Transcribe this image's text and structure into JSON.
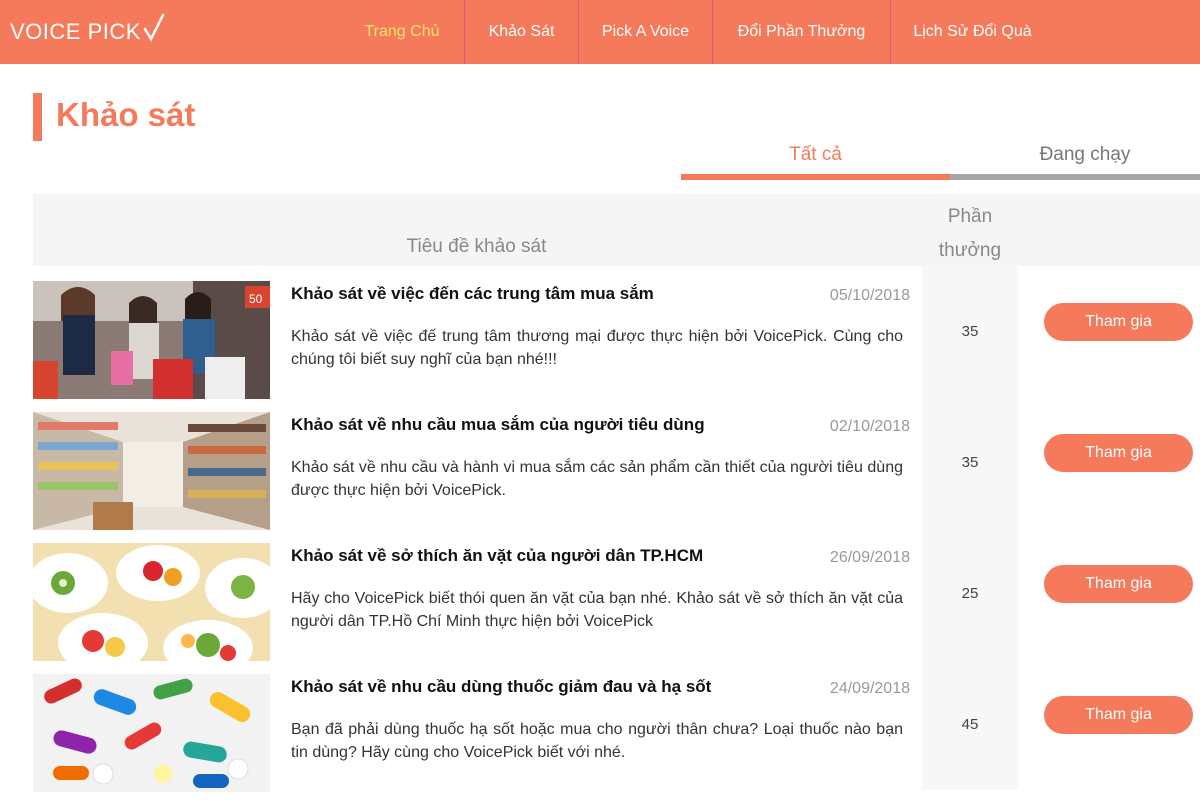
{
  "header": {
    "logo_text": "VOICE PICK",
    "nav": [
      {
        "label": "Trang Chủ",
        "active": true
      },
      {
        "label": "Khảo Sát",
        "active": false
      },
      {
        "label": "Pick A Voice",
        "active": false
      },
      {
        "label": "Đổi Phần Thưởng",
        "active": false
      },
      {
        "label": "Lịch Sử Đổi Quà",
        "active": false
      }
    ]
  },
  "page": {
    "title": "Khảo sát",
    "tabs": [
      {
        "label": "Tất cả",
        "active": true
      },
      {
        "label": "Đang chạy",
        "active": false
      }
    ]
  },
  "table": {
    "header_title": "Tiêu đề khảo sát",
    "header_reward_line1": "Phần",
    "header_reward_line2": "thưởng"
  },
  "surveys": [
    {
      "title": "Khảo sát về việc đến các trung tâm mua sắm",
      "date": "05/10/2018",
      "description": "Khảo sát về việc đế trung tâm thương mại được thực hiện bởi VoicePick. Cùng cho chúng tôi biết suy nghĩ của bạn nhé!!!",
      "reward": "35",
      "button": "Tham gia",
      "image": "shopping-women-photo"
    },
    {
      "title": "Khảo sát về nhu cầu mua sắm của người tiêu dùng",
      "date": "02/10/2018",
      "description": "Khảo sát về nhu cầu và hành vi mua sắm các sản phẩm cần thiết của người tiêu dùng được thực hiện bởi VoicePick.",
      "reward": "35",
      "button": "Tham gia",
      "image": "supermarket-aisle-photo"
    },
    {
      "title": "Khảo sát về sở thích ăn vặt của người dân TP.HCM",
      "date": "26/09/2018",
      "description": "Hãy cho VoicePick biết thói quen ăn vặt của bạn nhé. Khảo sát về sở thích ăn vặt của người dân TP.Hồ Chí Minh thực hiện bởi VoicePick",
      "reward": "25",
      "button": "Tham gia",
      "image": "fruit-salad-photo"
    },
    {
      "title": "Khảo sát về nhu cầu dùng thuốc giảm đau và hạ sốt",
      "date": "24/09/2018",
      "description": "Bạn đã phải dùng thuốc hạ sốt hoặc mua cho người thân chưa? Loại thuốc nào bạn tin dùng? Hãy cùng cho VoicePick biết với nhé.",
      "reward": "45",
      "button": "Tham gia",
      "image": "pills-capsules-photo"
    }
  ],
  "colors": {
    "brand": "#f47a5b",
    "nav_active": "#ffe26b",
    "tab_inactive": "#a7a7a7"
  }
}
